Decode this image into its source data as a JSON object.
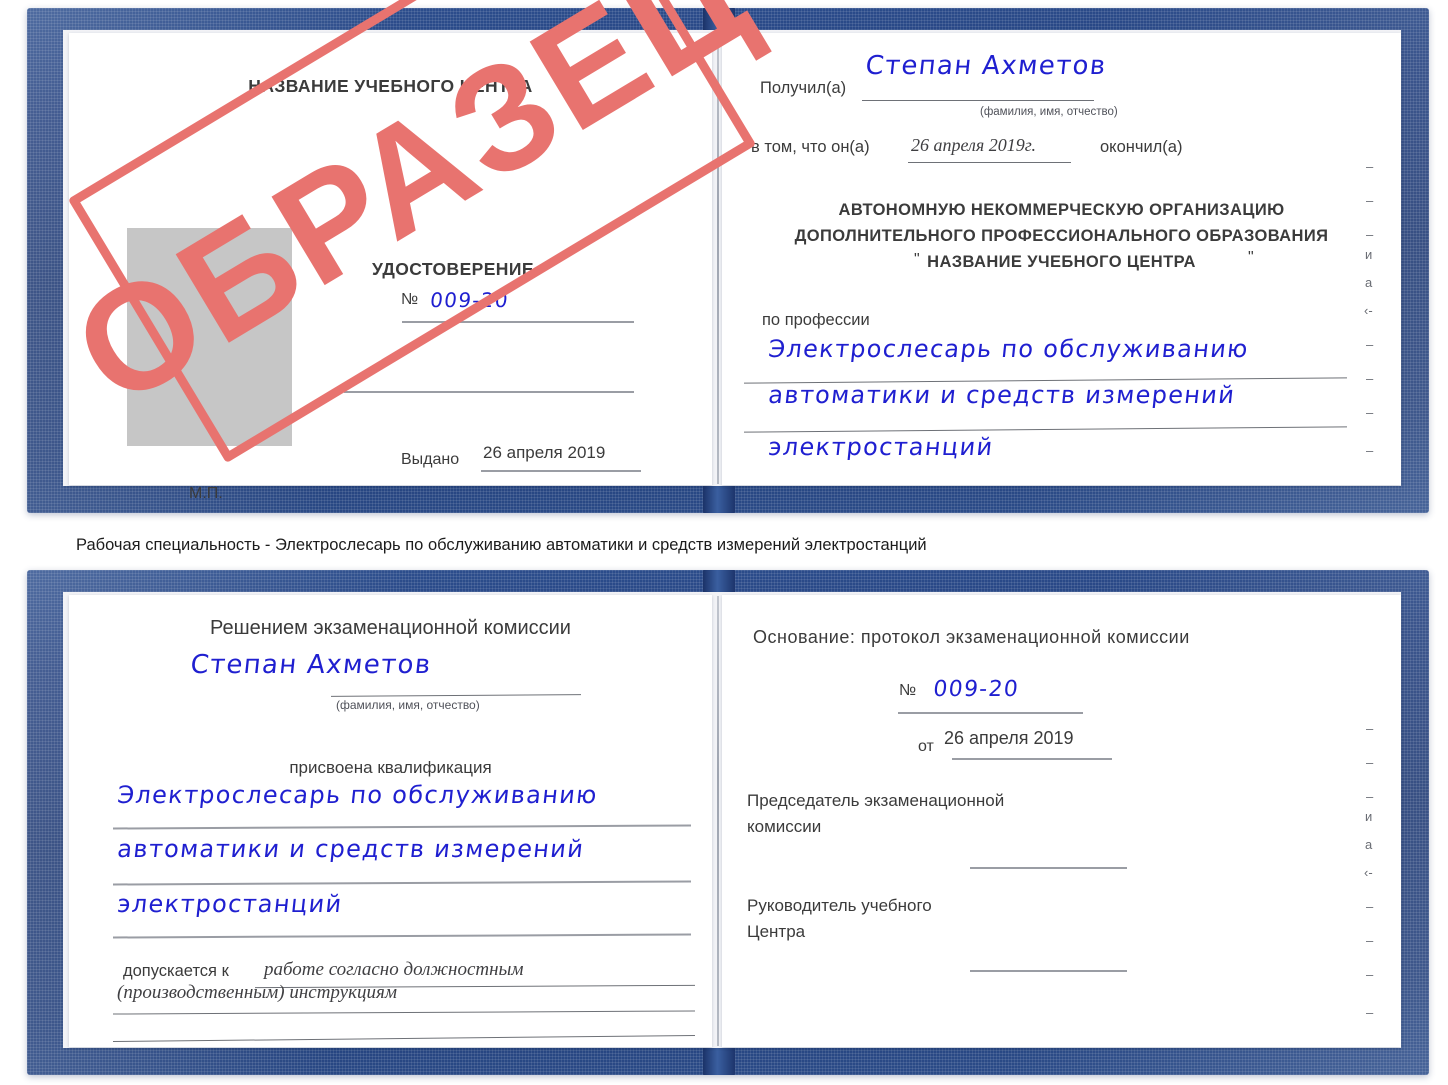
{
  "page": {
    "background_color": "#ffffff",
    "cover_color": "#24417c",
    "stamp_color": "#e8736f",
    "handwriting_color": "#1f1fd0",
    "photo_placeholder_color": "#c6c6c6"
  },
  "stamp": {
    "text": "ОБРАЗЕЦ"
  },
  "certificate_top": {
    "left_page": {
      "header": "НАЗВАНИЕ УЧЕБНОГО ЦЕНТРА",
      "doc_type": "УДОСТОВЕРЕНИЕ",
      "number_label": "№",
      "number_value": "009-20",
      "issued_label": "Выдано",
      "issued_value": "26 апреля 2019",
      "seal_label": "М.П.",
      "photo_placeholder": ""
    },
    "right_page": {
      "received_label": "Получил(а)",
      "received_value": "Степан Ахметов",
      "fio_hint": "(фамилия, имя, отчество)",
      "in_that_label": "в том, что он(а)",
      "graduation_date": "26 апреля 2019г.",
      "finished_label": "окончил(а)",
      "org_line1": "АВТОНОМНУЮ НЕКОММЕРЧЕСКУЮ ОРГАНИЗАЦИЮ",
      "org_line2": "ДОПОЛНИТЕЛЬНОГО ПРОФЕССИОНАЛЬНОГО ОБРАЗОВАНИЯ",
      "org_quote_open": "\"",
      "org_line3": "НАЗВАНИЕ УЧЕБНОГО ЦЕНТРА",
      "org_quote_close": "\"",
      "profession_label": "по профессии",
      "profession_line1": "Электрослесарь по обслуживанию",
      "profession_line2": "автоматики и средств измерений",
      "profession_line3": "электростанций",
      "edge_marks": [
        "–",
        "–",
        "–",
        "и",
        "а",
        "‹-",
        "–",
        "–",
        "–",
        "–"
      ]
    }
  },
  "caption": {
    "text": "Рабочая специальность - Электрослесарь по обслуживанию автоматики и средств измерений электростанций"
  },
  "certificate_bottom": {
    "left_page": {
      "decision_header": "Решением экзаменационной комиссии",
      "name_value": "Степан Ахметов",
      "fio_hint": "(фамилия, имя, отчество)",
      "qualification_label": "присвоена квалификация",
      "qualification_line1": "Электрослесарь по обслуживанию",
      "qualification_line2": "автоматики и средств измерений",
      "qualification_line3": "электростанций",
      "admitted_label": "допускается к",
      "admitted_value_line1": "работе согласно должностным",
      "admitted_value_line2": "(производственным) инструкциям"
    },
    "right_page": {
      "basis_label": "Основание: протокол экзаменационной комиссии",
      "protocol_number_label": "№",
      "protocol_number_value": "009-20",
      "protocol_date_label": "от",
      "protocol_date_value": "26 апреля 2019",
      "chairman_line1": "Председатель экзаменационной",
      "chairman_line2": "комиссии",
      "head_line1": "Руководитель учебного",
      "head_line2": "Центра",
      "edge_marks": [
        "–",
        "–",
        "–",
        "и",
        "а",
        "‹-",
        "–",
        "–",
        "–",
        "–"
      ]
    }
  }
}
